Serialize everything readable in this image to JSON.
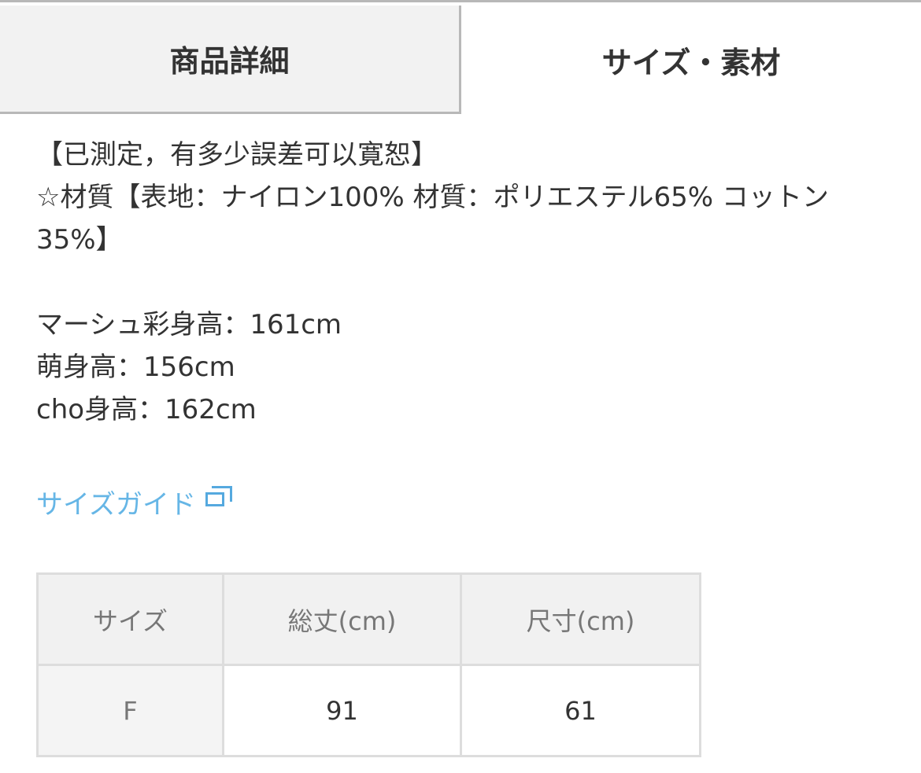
{
  "tabs": [
    {
      "label": "商品詳細",
      "active": false
    },
    {
      "label": "サイズ・素材",
      "active": true
    }
  ],
  "description": {
    "line_1": "【已測定，有多少誤差可以寛恕】",
    "line_2": "☆材質【表地：ナイロン100% 材質：ポリエステル65% コットン35%】",
    "line_3": "マーシュ彩身高：161cm",
    "line_4": "萌身高：156cm",
    "line_5": "cho身高：162cm"
  },
  "size_guide": {
    "label": "サイズガイド",
    "icon": "external-window-icon",
    "color": "#66b6e6"
  },
  "size_table": {
    "headers": [
      "サイズ",
      "総丈(cm)",
      "尺寸(cm)"
    ],
    "rows": [
      [
        "F",
        "91",
        "61"
      ]
    ]
  },
  "colors": {
    "tab_inactive_bg": "#f2f2f2",
    "border": "#dddddd",
    "text": "#333333"
  }
}
